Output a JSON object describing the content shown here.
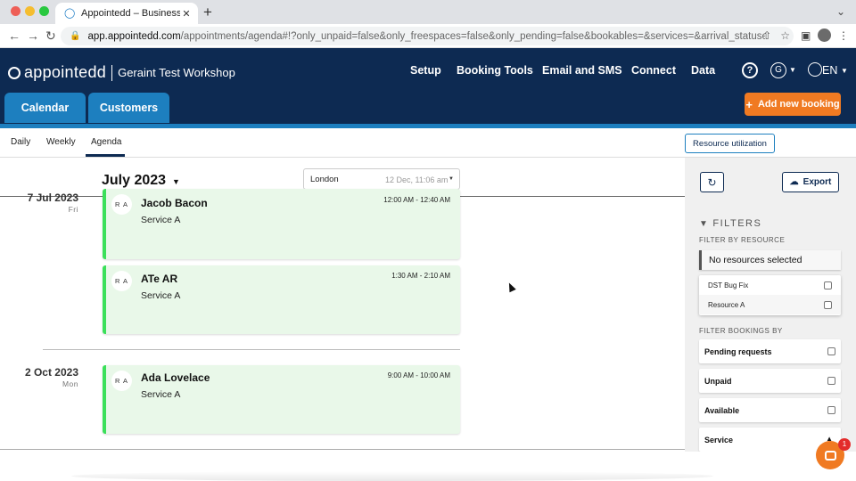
{
  "browser": {
    "tab_title": "Appointedd – Business Manag",
    "url_host": "app.appointedd.com",
    "url_path": "/appointments/agenda#!?only_unpaid=false&only_freespaces=false&only_pending=false&bookables=&services=&arrival_statuses=&created_sour..."
  },
  "app": {
    "logo_text": "appointedd",
    "business_name": "Geraint Test Workshop",
    "nav": [
      "Setup",
      "Booking Tools",
      "Email and SMS",
      "Connect",
      "Data"
    ],
    "help_label": "?",
    "user_initial": "G",
    "language": "EN",
    "tabs": [
      "Calendar",
      "Customers"
    ],
    "add_booking_label": "Add new booking",
    "colors": {
      "navy": "#0d2a52",
      "blue": "#1d7fbf",
      "orange": "#f07a22",
      "green_accent": "#3be05a",
      "card_bg": "#e9f8e9"
    }
  },
  "subnav": {
    "views": [
      "Daily",
      "Weekly",
      "Agenda"
    ],
    "active_view": "Agenda",
    "resource_utilization_label": "Resource utilization"
  },
  "agenda": {
    "month_label": "July 2023",
    "timezone": "London",
    "timezone_time": "12 Dec, 11:06 am",
    "groups": [
      {
        "date": "7 Jul 2023",
        "dow": "Fri",
        "bookings": [
          {
            "initials": "R A",
            "customer": "Jacob Bacon",
            "service": "Service A",
            "time": "12:00 AM - 12:40 AM"
          },
          {
            "initials": "R A",
            "customer": "ATe AR",
            "service": "Service A",
            "time": "1:30 AM - 2:10 AM"
          }
        ]
      },
      {
        "date": "2 Oct 2023",
        "dow": "Mon",
        "bookings": [
          {
            "initials": "R A",
            "customer": "Ada Lovelace",
            "service": "Service A",
            "time": "9:00 AM - 10:00 AM"
          }
        ]
      }
    ]
  },
  "sidebar": {
    "export_label": "Export",
    "filters_title": "FILTERS",
    "filter_by_resource_label": "FILTER BY RESOURCE",
    "resource_select_value": "No resources selected",
    "resources": [
      "DST Bug Fix",
      "Resource A"
    ],
    "filter_bookings_by_label": "FILTER BOOKINGS BY",
    "booking_filters": [
      "Pending requests",
      "Unpaid",
      "Available",
      "Service"
    ]
  },
  "chat": {
    "badge_count": "1"
  }
}
